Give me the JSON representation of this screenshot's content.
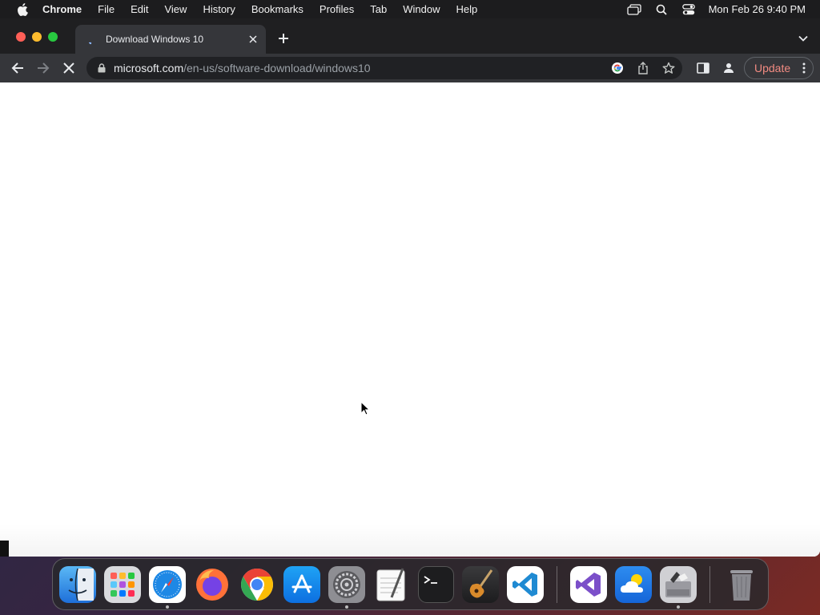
{
  "menubar": {
    "app_name": "Chrome",
    "items": [
      "File",
      "Edit",
      "View",
      "History",
      "Bookmarks",
      "Profiles",
      "Tab",
      "Window",
      "Help"
    ],
    "datetime": "Mon Feb 26  9:40 PM"
  },
  "browser": {
    "tab_title": "Download Windows 10",
    "url_host": "microsoft.com",
    "url_path": "/en-us/software-download/windows10",
    "update_label": "Update",
    "loading": true
  },
  "dock": {
    "apps": [
      "finder",
      "launchpad",
      "safari",
      "firefox",
      "chrome",
      "app-store",
      "system-preferences",
      "textedit",
      "terminal",
      "garageband",
      "vscode",
      "visual-studio",
      "weather",
      "boot-camp",
      "trash"
    ]
  },
  "colors": {
    "accent_update": "#f28b82",
    "tab_active": "#35363a",
    "chrome_frame": "#1f1f21"
  }
}
